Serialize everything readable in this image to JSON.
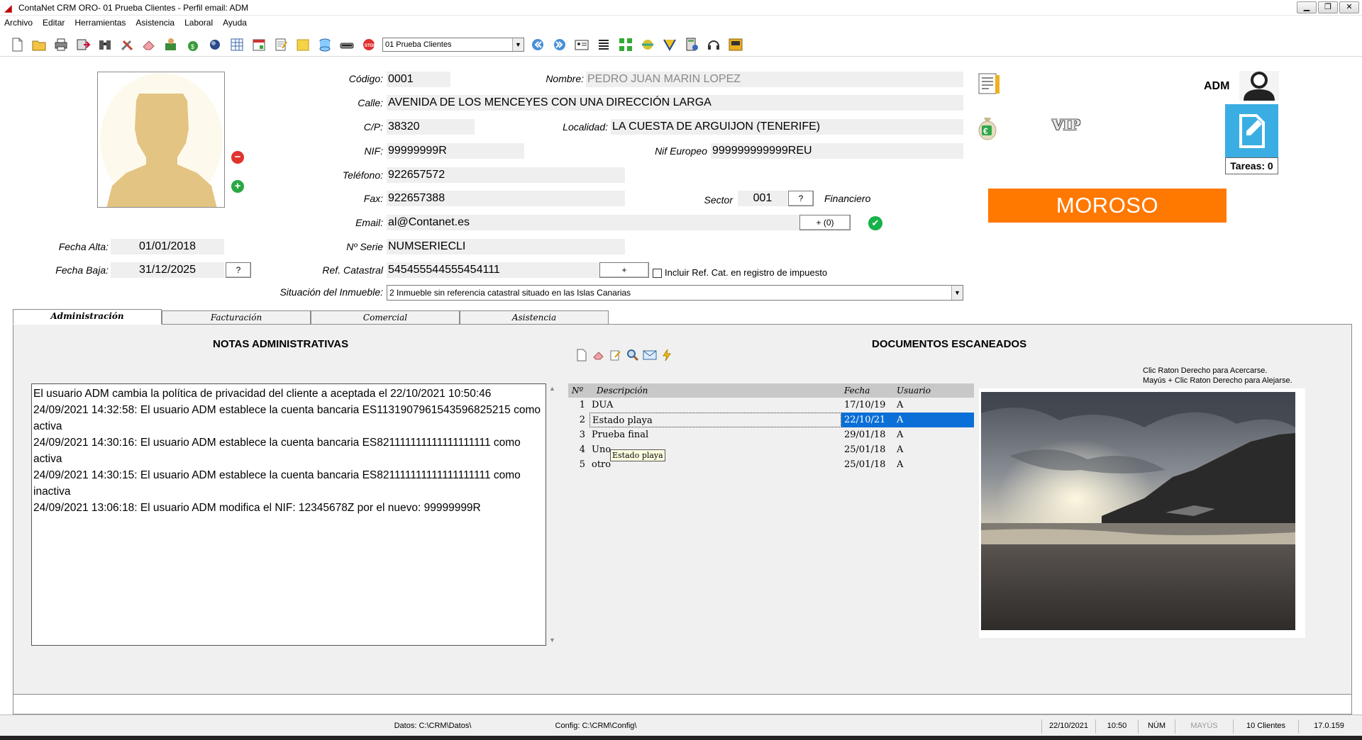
{
  "window": {
    "title": "ContaNet CRM ORO- 01 Prueba Clientes  -  Perfil email: ADM"
  },
  "menu": [
    "Archivo",
    "Editar",
    "Herramientas",
    "Asistencia",
    "Laboral",
    "Ayuda"
  ],
  "toolbar": {
    "company_select": "01 Prueba Clientes"
  },
  "client": {
    "codigo_label": "Código:",
    "codigo": "0001",
    "nombre_label": "Nombre:",
    "nombre": "PEDRO JUAN MARIN LOPEZ",
    "calle_label": "Calle:",
    "calle": "AVENIDA DE LOS MENCEYES CON UNA DIRECCIÓN LARGA",
    "cp_label": "C/P:",
    "cp": "38320",
    "localidad_label": "Localidad:",
    "localidad": "LA CUESTA DE ARGUIJON (TENERIFE)",
    "nif_label": "NIF:",
    "nif": "99999999R",
    "nif_europeo_label": "Nif Europeo",
    "nif_europeo": "999999999999REU",
    "telefono_label": "Teléfono:",
    "telefono": "922657572",
    "fax_label": "Fax:",
    "fax": "922657388",
    "sector_label": "Sector",
    "sector": "001",
    "sector_btn": "?",
    "sector_name": "Financiero",
    "email_label": "Email:",
    "email": "al@Contanet.es",
    "email_btn": "+ (0)",
    "serie_label": "Nº Serie",
    "serie": "NUMSERIECLI",
    "catastral_label": "Ref. Catastral",
    "catastral": "545455544555454111",
    "catastral_btn": "+",
    "incluir_label": "Incluir Ref. Cat. en registro de impuesto",
    "situacion_label": "Situación del Inmueble:",
    "situacion": "2 Inmueble sin referencia catastral situado en las Islas Canarias",
    "fecha_alta_label": "Fecha Alta:",
    "fecha_alta": "01/01/2018",
    "fecha_baja_label": "Fecha Baja:",
    "fecha_baja": "31/12/2025",
    "fecha_baja_btn": "?"
  },
  "side": {
    "user": "ADM",
    "tareas": "Tareas: 0",
    "vip": "VIP",
    "moroso": "MOROSO"
  },
  "tabs": [
    "Administración",
    "Facturación",
    "Comercial",
    "Asistencia"
  ],
  "notes": {
    "title": "NOTAS ADMINISTRATIVAS",
    "lines": [
      "El usuario ADM cambia la política de privacidad del cliente a aceptada el 22/10/2021 10:50:46",
      "24/09/2021 14:32:58: El usuario ADM establece la cuenta bancaria ES1131907961543596825215 como activa",
      "24/09/2021 14:30:16: El usuario ADM establece la cuenta bancaria ES821111111111111111111 como activa",
      "24/09/2021 14:30:15: El usuario ADM establece la cuenta bancaria ES821111111111111111111 como inactiva",
      "24/09/2021 13:06:18: El usuario ADM modifica el NIF: 12345678Z por el nuevo: 99999999R"
    ]
  },
  "documents": {
    "title": "DOCUMENTOS ESCANEADOS",
    "headers": [
      "Nº",
      "Descripción",
      "Fecha",
      "Usuario"
    ],
    "rows": [
      {
        "n": "1",
        "desc": "DUA",
        "fecha": "17/10/19",
        "user": "A"
      },
      {
        "n": "2",
        "desc": "Estado playa",
        "fecha": "22/10/21",
        "user": "A"
      },
      {
        "n": "3",
        "desc": "Prueba final",
        "fecha": "29/01/18",
        "user": "A"
      },
      {
        "n": "4",
        "desc": "Uno",
        "fecha": "25/01/18",
        "user": "A"
      },
      {
        "n": "5",
        "desc": "otro",
        "fecha": "25/01/18",
        "user": "A"
      }
    ],
    "selected_index": 1,
    "tooltip": "Estado playa",
    "hint_line1": "Clic Raton Derecho para Acercarse.",
    "hint_line2": "Mayús + Clic Raton Derecho para Alejarse."
  },
  "status": {
    "datos": "Datos: C:\\CRM\\Datos\\",
    "config": "Config: C:\\CRM\\Config\\",
    "date": "22/10/2021",
    "time": "10:50",
    "num": "NÚM",
    "mayus": "MAYÚS",
    "clientes": "10 Clientes",
    "version": "17.0.159"
  },
  "colors": {
    "moroso": "#ff7800",
    "tareas_tile": "#3aaee2",
    "selection": "#0a6fd6"
  }
}
